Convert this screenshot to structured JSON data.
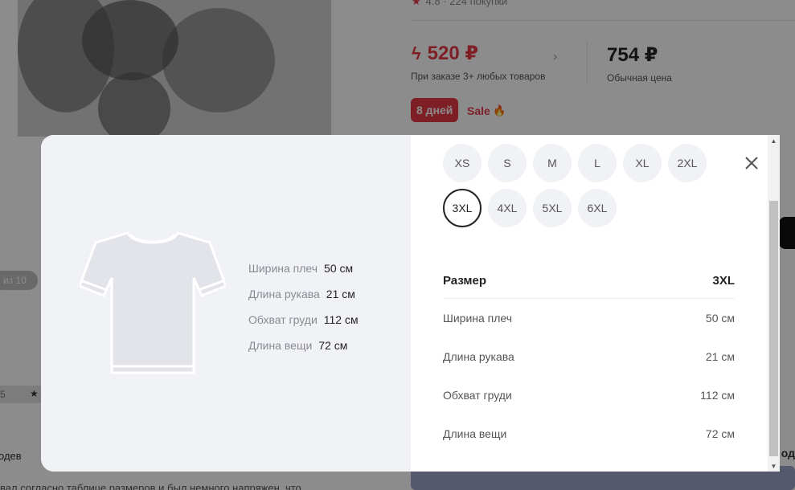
{
  "background": {
    "rating_text": "4.8 · 224 покупки",
    "price_discount": "520 ₽",
    "price_discount_note": "При заказе 3+ любых товаров",
    "price_regular": "754 ₽",
    "price_regular_note": "Обычная цена",
    "days_badge": "8 дней",
    "sale_label": "Sale",
    "pill_iz": "из 10",
    "pill_small": "5",
    "text_left": "одев",
    "text_bottom": "вал согласно таблице размеров и был немного напряжен, что",
    "text_right": "од",
    "accent_color": "#e53945"
  },
  "modal": {
    "left_measures": [
      {
        "label": "Ширина плеч",
        "value": "50 см"
      },
      {
        "label": "Длина рукава",
        "value": "21 см"
      },
      {
        "label": "Обхват груди",
        "value": "112 см"
      },
      {
        "label": "Длина вещи",
        "value": "72 см"
      }
    ],
    "sizes": [
      "XS",
      "S",
      "M",
      "L",
      "XL",
      "2XL",
      "3XL",
      "4XL",
      "5XL",
      "6XL"
    ],
    "selected_size": "3XL",
    "table": {
      "header_label": "Размер",
      "header_value": "3XL",
      "rows": [
        {
          "label": "Ширина плеч",
          "value": "50 см"
        },
        {
          "label": "Длина рукава",
          "value": "21 см"
        },
        {
          "label": "Обхват груди",
          "value": "112 см"
        },
        {
          "label": "Длина вещи",
          "value": "72 см"
        }
      ]
    },
    "close_icon": "close-icon"
  }
}
